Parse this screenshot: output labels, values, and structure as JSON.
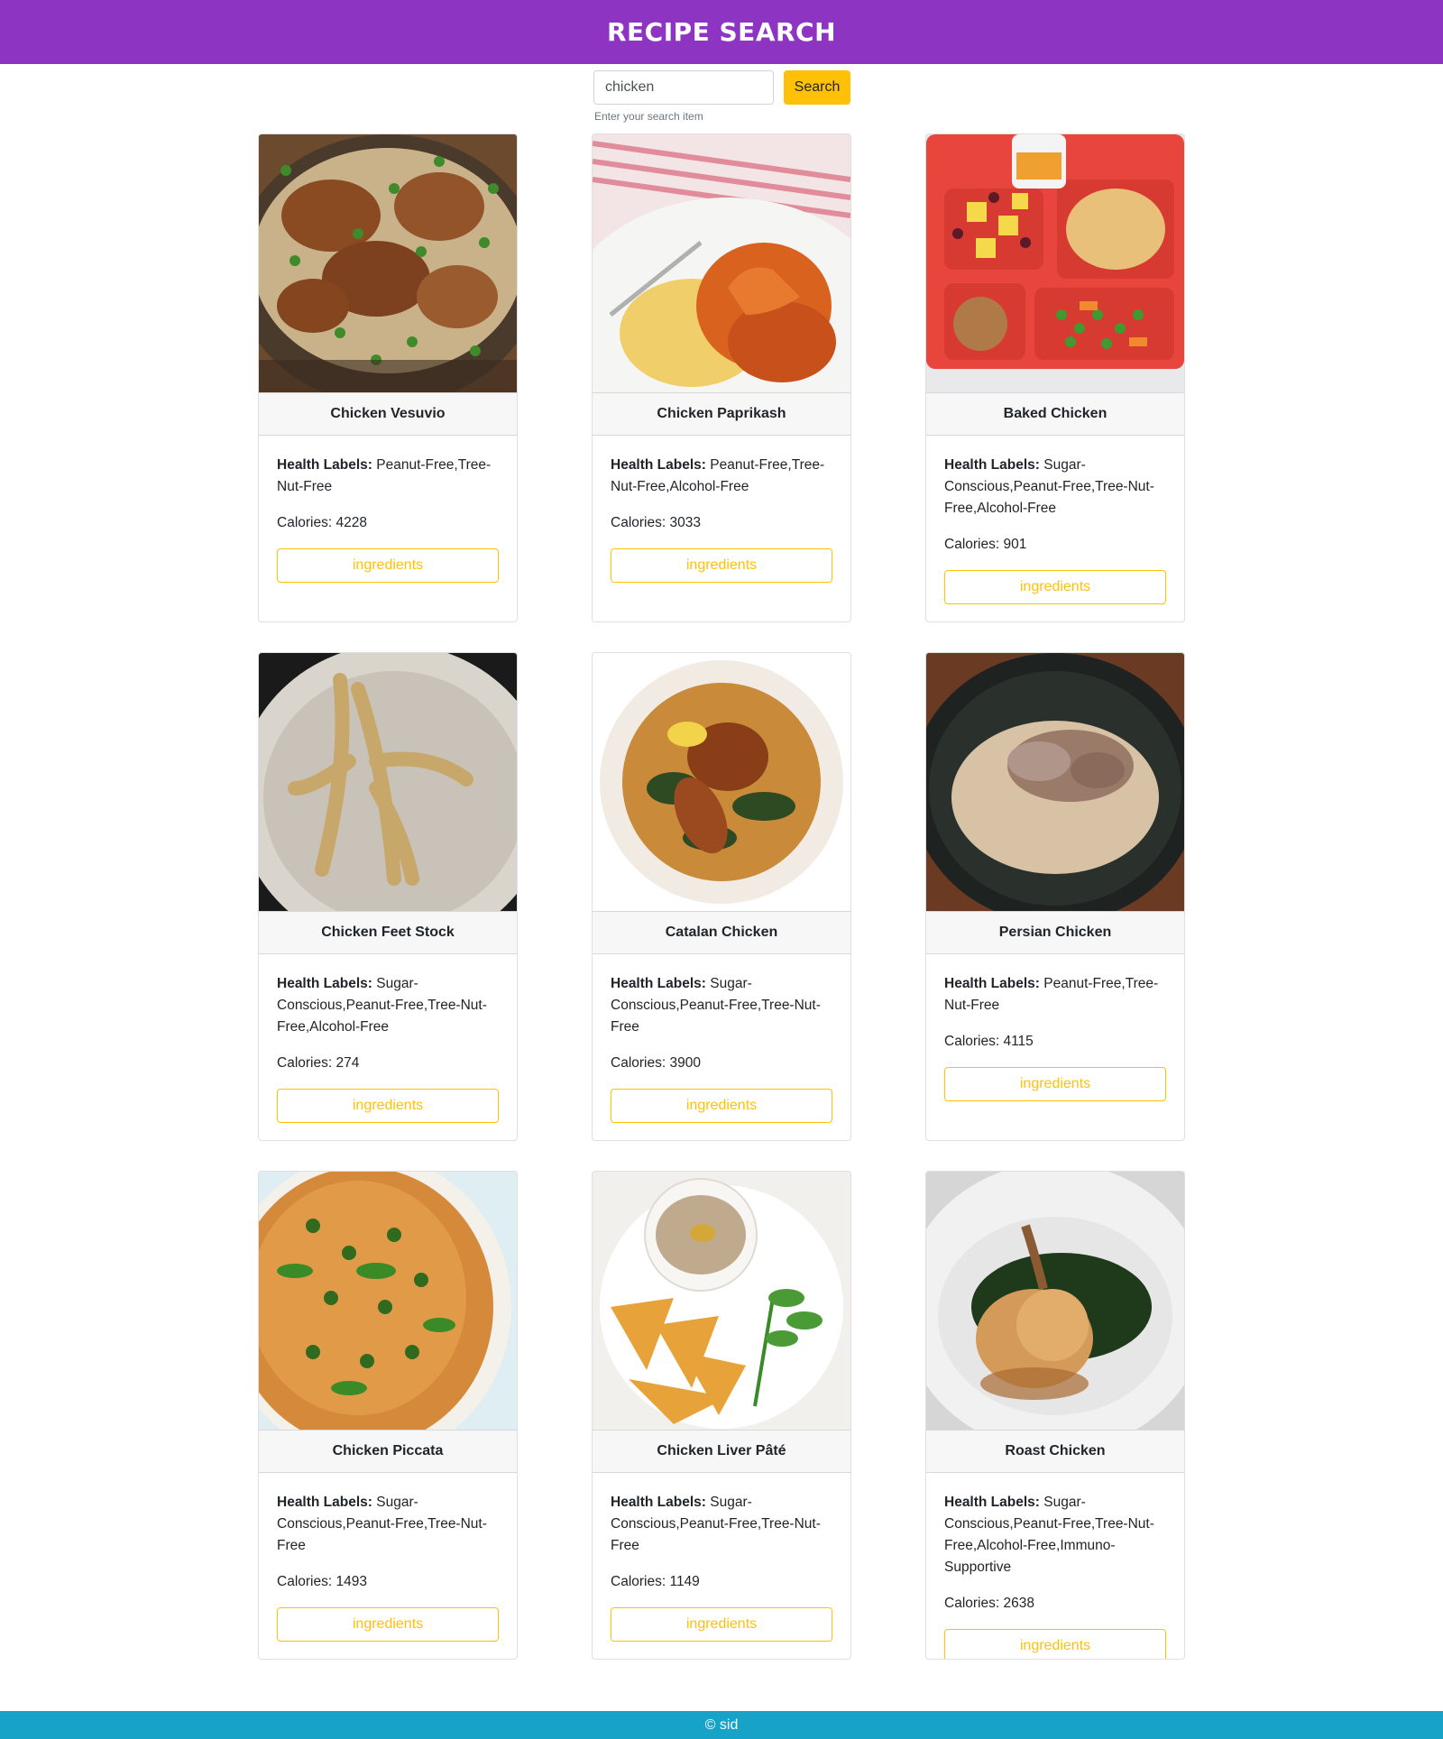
{
  "header": {
    "title": "RECIPE SEARCH"
  },
  "search": {
    "value": "chicken",
    "button_label": "Search",
    "help": "Enter your search item"
  },
  "health_label_prefix": "Health Labels:",
  "calories_prefix": "Calories: ",
  "ingredients_label": "ingredients",
  "recipes": [
    {
      "title": "Chicken Vesuvio",
      "health": "Peanut-Free,Tree-Nut-Free",
      "calories": "4228",
      "image": "chicken-vesuvio-photo"
    },
    {
      "title": "Chicken Paprikash",
      "health": "Peanut-Free,Tree-Nut-Free,Alcohol-Free",
      "calories": "3033",
      "image": "chicken-paprikash-photo"
    },
    {
      "title": "Baked Chicken",
      "health": "Sugar-Conscious,Peanut-Free,Tree-Nut-Free,Alcohol-Free",
      "calories": "901",
      "image": "baked-chicken-tray-photo"
    },
    {
      "title": "Chicken Feet Stock",
      "health": "Sugar-Conscious,Peanut-Free,Tree-Nut-Free,Alcohol-Free",
      "calories": "274",
      "image": "chicken-feet-plate-photo"
    },
    {
      "title": "Catalan Chicken",
      "health": "Sugar-Conscious,Peanut-Free,Tree-Nut-Free",
      "calories": "3900",
      "image": "catalan-chicken-bowl-photo"
    },
    {
      "title": "Persian Chicken",
      "health": "Peanut-Free,Tree-Nut-Free",
      "calories": "4115",
      "image": "persian-chicken-rice-photo"
    },
    {
      "title": "Chicken Piccata",
      "health": "Sugar-Conscious,Peanut-Free,Tree-Nut-Free",
      "calories": "1493",
      "image": "chicken-piccata-photo"
    },
    {
      "title": "Chicken Liver Pâté",
      "health": "Sugar-Conscious,Peanut-Free,Tree-Nut-Free",
      "calories": "1149",
      "image": "chicken-liver-pate-photo"
    },
    {
      "title": "Roast Chicken",
      "health": "Sugar-Conscious,Peanut-Free,Tree-Nut-Free,Alcohol-Free,Immuno-Supportive",
      "calories": "2638",
      "image": "roast-chicken-photo"
    }
  ],
  "footer": {
    "text": "© sid"
  },
  "colors": {
    "header": "#8e34c2",
    "accent": "#ffc107",
    "footer": "#17a2c8"
  }
}
